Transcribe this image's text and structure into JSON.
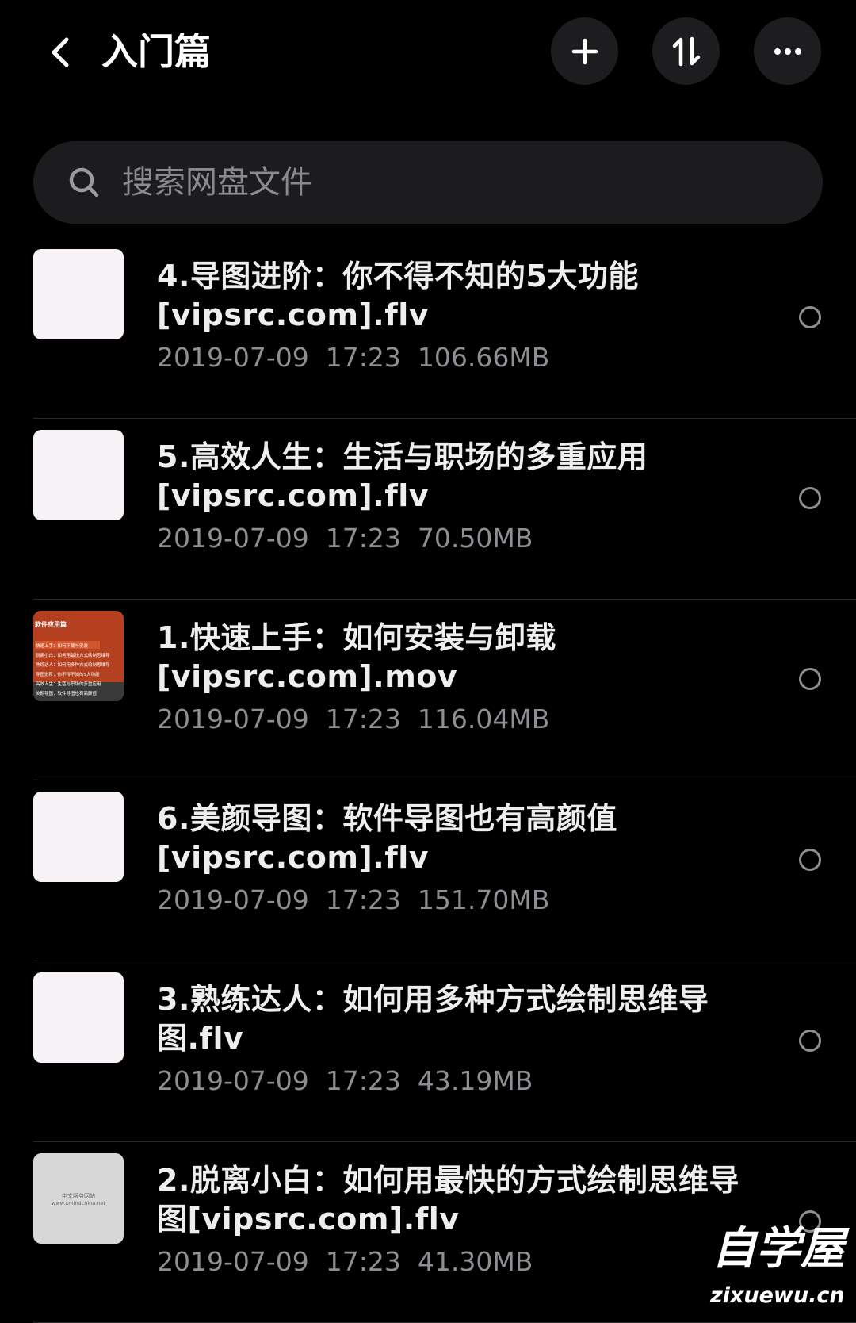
{
  "header": {
    "title": "入门篇"
  },
  "search": {
    "placeholder": "搜索网盘文件"
  },
  "files": [
    {
      "name": "4.导图进阶：你不得不知的5大功能[vipsrc.com].flv",
      "date": "2019-07-09",
      "time": "17:23",
      "size": "106.66MB",
      "thumb": "blank"
    },
    {
      "name": "5.高效人生：生活与职场的多重应用[vipsrc.com].flv",
      "date": "2019-07-09",
      "time": "17:23",
      "size": "70.50MB",
      "thumb": "blank"
    },
    {
      "name": "1.快速上手：如何安装与卸载[vipsrc.com].mov",
      "date": "2019-07-09",
      "time": "17:23",
      "size": "116.04MB",
      "thumb": "video",
      "thumb_text": {
        "title": "软件应用篇",
        "lines": [
          "快速上手：如何下载与安装",
          "脱离小白：如何用最快方式绘制思维导",
          "熟练达人：如何用多种方式绘制思维导",
          "导图进阶：你不得不知的5大功能",
          "高效人生：生活与职场的多重应用",
          "美颜导图：软件导图也有高颜值"
        ]
      }
    },
    {
      "name": "6.美颜导图：软件导图也有高颜值[vipsrc.com].flv",
      "date": "2019-07-09",
      "time": "17:23",
      "size": "151.70MB",
      "thumb": "blank"
    },
    {
      "name": "3.熟练达人：如何用多种方式绘制思维导图.flv",
      "date": "2019-07-09",
      "time": "17:23",
      "size": "43.19MB",
      "thumb": "blank"
    },
    {
      "name": "2.脱离小白：如何用最快的方式绘制思维导图[vipsrc.com].flv",
      "date": "2019-07-09",
      "time": "17:23",
      "size": "41.30MB",
      "thumb": "gray",
      "thumb_text": {
        "line1": "中文服务网站",
        "line2": "www.xmindchina.net"
      }
    }
  ],
  "watermark": {
    "big": "自学屋",
    "small": "zixuewu.cn"
  },
  "colors": {
    "background": "#000000",
    "button_bg": "#1d1d1f",
    "search_bg": "#1c1c1e",
    "secondary_text": "#8e8e93"
  },
  "icons": {
    "back": "chevron-left-icon",
    "add": "plus-icon",
    "sort": "sort-icon",
    "more": "more-icon",
    "search": "search-icon"
  }
}
